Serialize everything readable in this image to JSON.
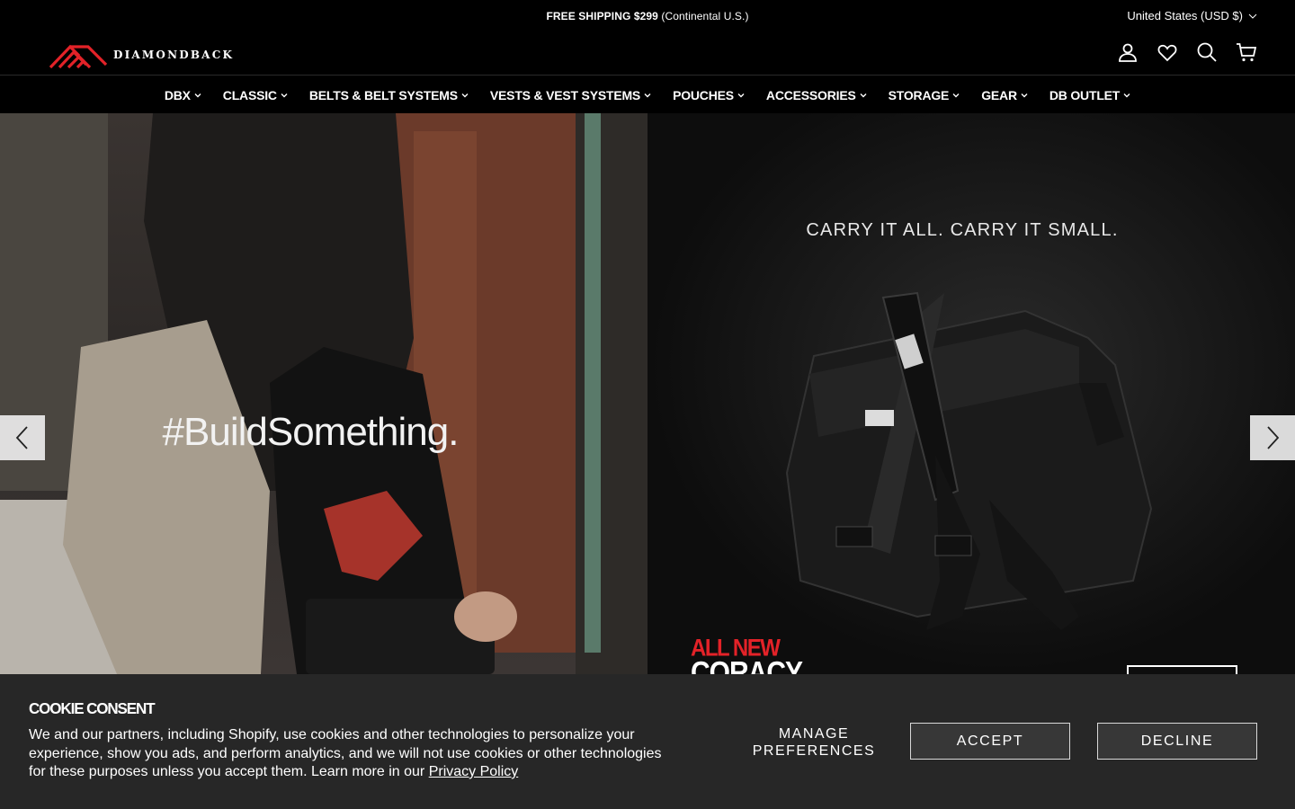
{
  "announcement": {
    "bold": "FREE SHIPPING $299",
    "rest": " (Continental U.S.)"
  },
  "currency": {
    "label": "United States (USD $)"
  },
  "logo": {
    "wordmark": "DIAMONDBACK",
    "accent_color": "#e32228"
  },
  "header_icons": [
    "account-icon",
    "wishlist-heart-icon",
    "search-icon",
    "cart-icon"
  ],
  "nav": {
    "items": [
      {
        "label": "DBX"
      },
      {
        "label": "CLASSIC"
      },
      {
        "label": "BELTS & BELT SYSTEMS"
      },
      {
        "label": "VESTS & VEST SYSTEMS"
      },
      {
        "label": "POUCHES"
      },
      {
        "label": "ACCESSORIES"
      },
      {
        "label": "STORAGE"
      },
      {
        "label": "GEAR"
      },
      {
        "label": "DB OUTLET"
      }
    ]
  },
  "hero": {
    "left": {
      "hashtag": "#BuildSomething."
    },
    "right": {
      "tagline": "CARRY IT ALL. CARRY IT SMALL.",
      "badge": "ALL NEW",
      "product": "CORACY"
    }
  },
  "cookie": {
    "title": "COOKIE CONSENT",
    "body": "We and our partners, including Shopify, use cookies and other technologies to personalize your experience, show you ads, and perform analytics, and we will not use cookies or other technologies for these purposes unless you accept them. Learn more in our ",
    "link": "Privacy Policy",
    "manage_line1": "MANAGE",
    "manage_line2": "PREFERENCES",
    "accept": "ACCEPT",
    "decline": "DECLINE"
  }
}
